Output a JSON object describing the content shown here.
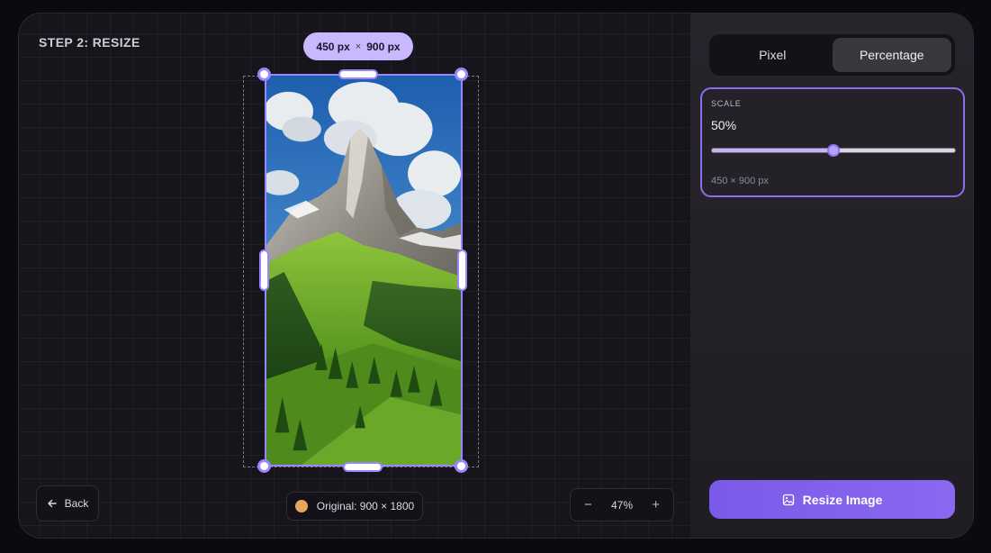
{
  "step_title": "STEP 2: RESIZE",
  "dimensions": {
    "width": "450 px",
    "sep": "×",
    "height": "900 px"
  },
  "back_label": "Back",
  "original_label": "Original: 900 × 1800",
  "zoom": {
    "minus": "−",
    "value": "47%",
    "plus": "+"
  },
  "mode_tabs": [
    {
      "label": "Pixel",
      "active": false
    },
    {
      "label": "Percentage",
      "active": true
    }
  ],
  "scale": {
    "label": "SCALE",
    "value": "50%",
    "level": 0.5,
    "result": "450 × 900 px"
  },
  "resize_button": "Resize Image",
  "colors": {
    "accent": "#9b86ff",
    "button": "#7a5ae8",
    "original_dot": "#e8a85c"
  }
}
